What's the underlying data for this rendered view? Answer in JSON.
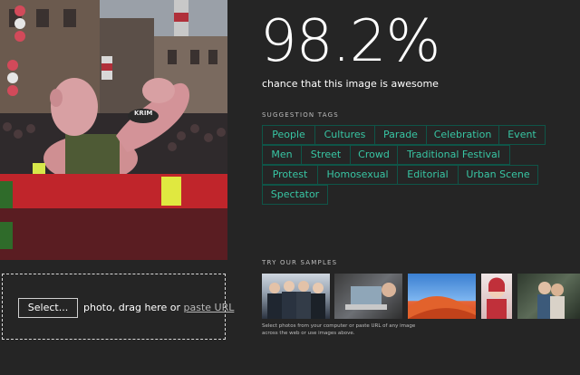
{
  "result": {
    "score": "98.2%",
    "caption": "chance that this image is awesome"
  },
  "tags_section": {
    "heading": "SUGGESTION TAGS",
    "tags": [
      "People",
      "Cultures",
      "Parade",
      "Celebration",
      "Event",
      "Men",
      "Street",
      "Crowd",
      "Traditional Festival",
      "Protest",
      "Homosexual",
      "Editorial",
      "Urban Scene",
      "Spectator"
    ],
    "tag_color": "#38c6a4",
    "tag_border_color": "#0f5548"
  },
  "upload": {
    "select_label": "Select...",
    "instruction": "photo, drag here or",
    "paste_url_label": "paste URL"
  },
  "samples_section": {
    "heading": "TRY OUR SAMPLES",
    "hint": "Select photos from your computer or paste URL of any image across the web or use images above."
  },
  "analyzed_image": {
    "float_badge_text": "KRIM"
  },
  "theme": {
    "background": "#252525",
    "text": "#ffffff",
    "muted_text": "#bdbdbd"
  }
}
